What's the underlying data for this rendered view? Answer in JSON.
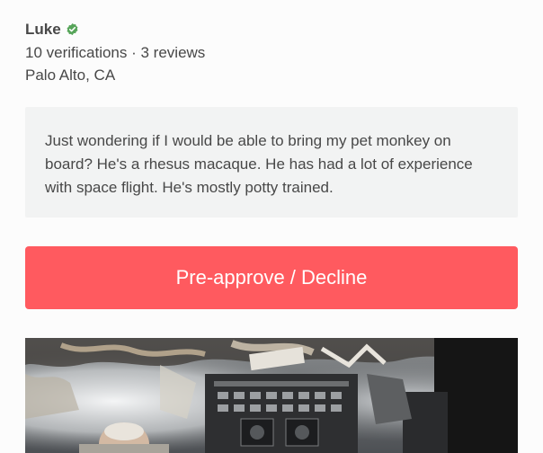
{
  "host": {
    "name": "Luke",
    "verifications": "10 verifications · 3 reviews",
    "location": "Palo Alto, CA"
  },
  "message": {
    "text": "Just wondering if I would be able to bring my pet monkey on board? He's a rhesus macaque. He has had a lot of experience with space flight. He's mostly potty trained."
  },
  "action": {
    "label": "Pre-approve / Decline"
  },
  "colors": {
    "accent": "#ff5a5f",
    "verified": "#57a55a",
    "message_bg": "#f2f3f3",
    "text": "#484848"
  },
  "icons": {
    "verified": "verified-check-icon"
  }
}
